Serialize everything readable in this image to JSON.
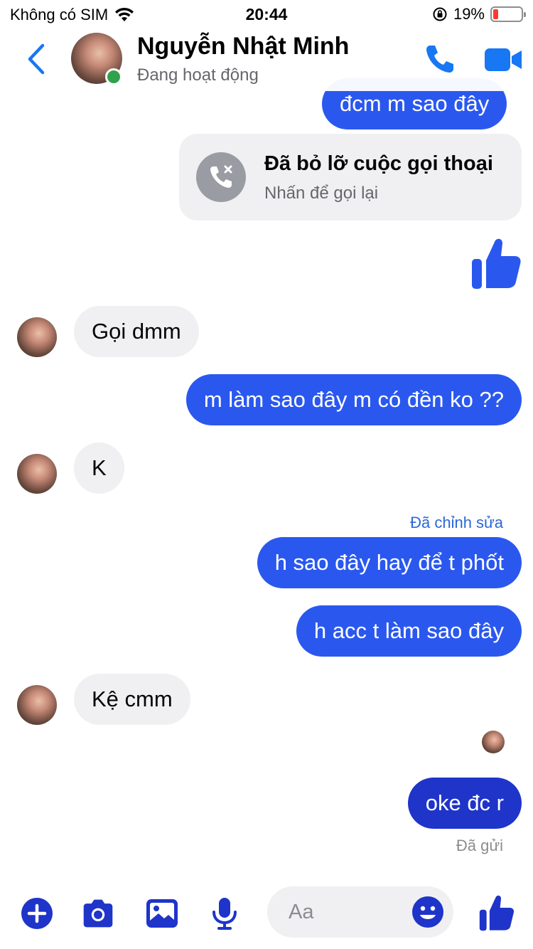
{
  "status_bar": {
    "carrier": "Không có SIM",
    "time": "20:44",
    "battery_percent": "19%",
    "battery_level": 0.19,
    "battery_color": "#ff3b30"
  },
  "header": {
    "name": "Nguyễn Nhật Minh",
    "status": "Đang hoạt động",
    "online_color": "#31a24c",
    "accent": "#1877f2"
  },
  "messages": [
    {
      "from": "me",
      "text": "đcm m sao đây"
    },
    {
      "from": "me",
      "type": "missed_call",
      "title": "Đã bỏ lỡ cuộc gọi thoại",
      "subtitle": "Nhấn để gọi lại"
    },
    {
      "from": "me",
      "type": "like",
      "icon": "thumbs-up-icon"
    },
    {
      "from": "them",
      "text": "Gọi dmm"
    },
    {
      "from": "me",
      "text": "m làm sao đây m có đền ko ??"
    },
    {
      "from": "them",
      "text": "K"
    },
    {
      "from": "me",
      "text": "h sao đây hay để t phốt",
      "note": "Đã chỉnh sửa"
    },
    {
      "from": "me",
      "text": "h acc t làm sao đây"
    },
    {
      "from": "them",
      "text": "Kệ cmm"
    },
    {
      "from": "me",
      "text": "oke đc r",
      "receipt": "Đã gửi"
    }
  ],
  "composer": {
    "placeholder": "Aa",
    "icons": [
      "plus-icon",
      "camera-icon",
      "gallery-icon",
      "microphone-icon",
      "emoji-icon",
      "thumbs-up-icon"
    ]
  },
  "colors": {
    "outgoing_bubble": "#2a58ef",
    "incoming_bubble": "#f0f0f2",
    "composer_icons": "#1f34c9"
  }
}
